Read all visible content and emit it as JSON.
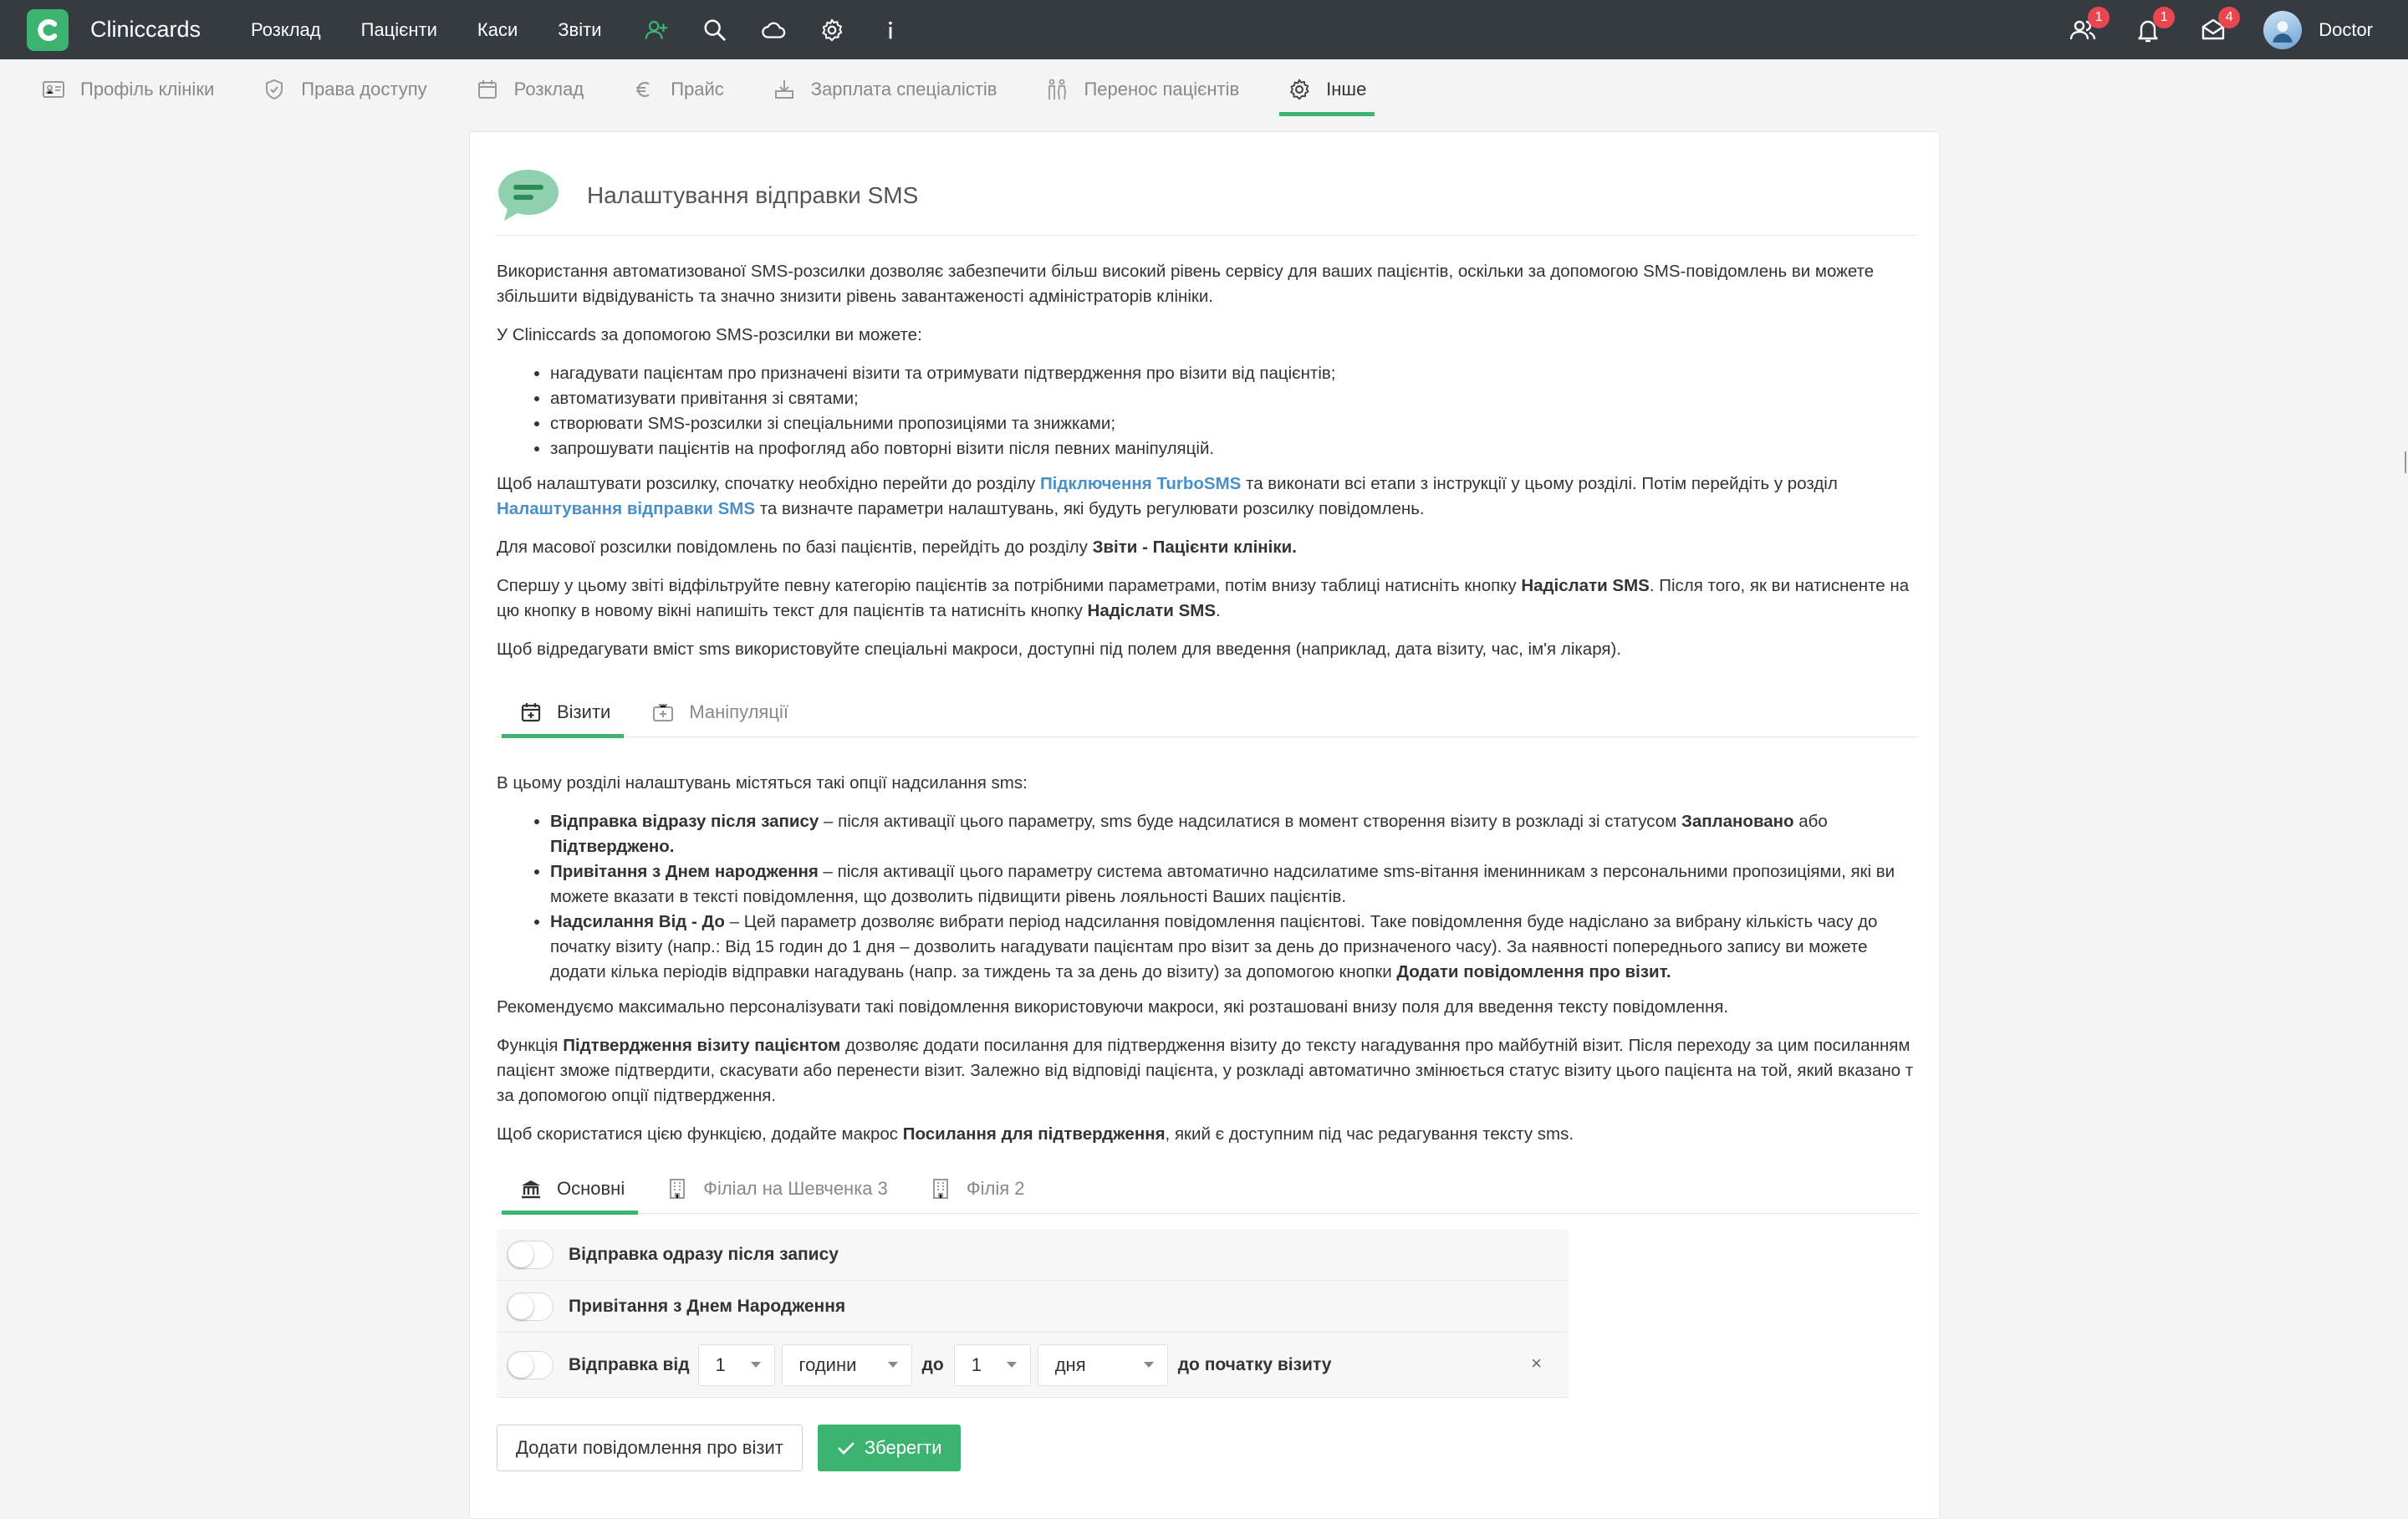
{
  "topbar": {
    "app_name": "Cliniccards",
    "nav": [
      "Розклад",
      "Пацієнти",
      "Каси",
      "Звіти"
    ],
    "icons": [
      "add-user-icon",
      "search-icon",
      "cloud-icon",
      "gear-icon",
      "info-icon"
    ],
    "badges": {
      "users": "1",
      "notifications": "1",
      "messages": "4"
    },
    "user_name": "Doctor",
    "colors": {
      "bar": "#363a41",
      "accent": "#3cb371",
      "badge": "#e8474f"
    }
  },
  "subnav": {
    "items": [
      "Профіль клініки",
      "Права доступу",
      "Розклад",
      "Прайс",
      "Зарплата спеціалістів",
      "Перенос пацієнтів",
      "Інше"
    ],
    "active": "Інше"
  },
  "card": {
    "title": "Налаштування відправки SMS",
    "intro": "Використання автоматизованої SMS-розсилки дозволяє забезпечити більш високий рівень сервісу для ваших пацієнтів, оскільки за допомогою SMS-повідомлень ви можете збільшити відвідуваність та значно знизити рівень завантаженості адміністраторів клініки.",
    "can_title": "У Cliniccards за допомогою SMS-розсилки ви можете:",
    "can_list": [
      "нагадувати пацієнтам про призначені візити та отримувати підтвердження про візити від пацієнтів;",
      "автоматизувати привітання зі святами;",
      "створювати SMS-розсилки зі спеціальними пропозиціями та знижками;",
      "запрошувати пацієнтів на профогляд або повторні візити після певних маніпуляцій."
    ],
    "p_setup": {
      "t1": "Щоб налаштувати розсилку, спочатку необхідно перейти до розділу ",
      "link1": "Підключення TurboSMS",
      "t2": " та виконати всі етапи з інструкції у цьому розділі. Потім перейдіть у розділ ",
      "link2": "Налаштування відправки SMS",
      "t3": " та визначте параметри налаштувань, які будуть регулювати розсилку повідомлень."
    },
    "p_mass": {
      "t1": "Для масової розсилки повідомлень по базі пацієнтів, перейдіть до розділу ",
      "b1": "Звіти - Пацієнти клініки."
    },
    "p_filter": {
      "t1": "Спершу у цьому звіті відфільтруйте певну категорію пацієнтів за потрібними параметрами, потім внизу таблиці натисніть кнопку ",
      "b1": "Надіслати SMS",
      "t2": ". Після того, як ви натисненте на цю кнопку в новому вікні напишіть текст для пацієнтів та натисніть кнопку ",
      "b2": "Надіслати SMS",
      "t3": "."
    },
    "p_macros": "Щоб відредагувати вміст sms використовуйте спеціальні макроси, доступні під полем для введення (наприклад, дата візиту, час, ім'я лікаря).",
    "tabs1": [
      "Візити",
      "Маніпуляції"
    ],
    "visits_intro": "В цьому розділі налаштувань містяться такі опції надсилання sms:",
    "opt1": {
      "b": "Відправка відразу після запису",
      "t1": " – після активації цього параметру, sms буде надсилатися в момент створення візиту в розкладі зі статусом ",
      "b2": "Заплановано",
      "t2": " або ",
      "b3": "Підтверджено."
    },
    "opt2": {
      "b": "Привітання з Днем народження",
      "t1": " – після активації цього параметру система автоматично надсилатиме sms-вітання іменинникам з персональними пропозиціями, які ви можете вказати в тексті повідомлення, що дозволить підвищити рівень лояльності Ваших пацієнтів."
    },
    "opt3": {
      "b": "Надсилання Від - До",
      "t1": " – Цей параметр дозволяє вибрати період надсилання повідомлення пацієнтові. Таке повідомлення буде надіслано за вибрану кількість часу до початку візиту (напр.: Від 15 годин до 1 дня – дозволить нагадувати пацієнтам про візит за день до призначеного часу). За наявності попереднього запису ви можете додати кілька періодів відправки нагадувань (напр. за тиждень та за день до візиту) за допомогою кнопки ",
      "b2": "Додати повідомлення про візит."
    },
    "p_recommend": "Рекомендуємо максимально персоналізувати такі повідомлення використовуючи макроси, які розташовані внизу поля для введення тексту повідомлення.",
    "p_confirm": {
      "t1": "Функція ",
      "b1": "Підтвердження візиту пацієнтом",
      "t2": " дозволяє додати посилання для підтвердження візиту до тексту нагадування про майбутній візит. Після переходу за цим посиланням пацієнт зможе підтвердити, скасувати або перенести візит. Залежно від відповіді пацієнта, у розкладі автоматично змінюється статус візиту цього пацієнта на той, який вказано т за допомогою опції підтвердження."
    },
    "p_use": {
      "t1": "Щоб скористатися цією функцією, додайте макрос ",
      "b1": "Посилання для підтвердження",
      "t2": ", який є доступним під час редагування тексту sms."
    },
    "tabs2": [
      "Основні",
      "Філіал на Шевченка 3",
      "Філія 2"
    ],
    "settings": {
      "row1": "Відправка одразу після запису",
      "row2": "Привітання з Днем Народження",
      "row3_from": "Відправка від",
      "from_value": "1",
      "from_unit": "години",
      "to_word": "до",
      "to_value": "1",
      "to_unit": "дня",
      "row3_tail": "до початку візиту",
      "remove": "×"
    },
    "buttons": {
      "add": "Додати повідомлення про візит",
      "save": "Зберегти"
    }
  }
}
